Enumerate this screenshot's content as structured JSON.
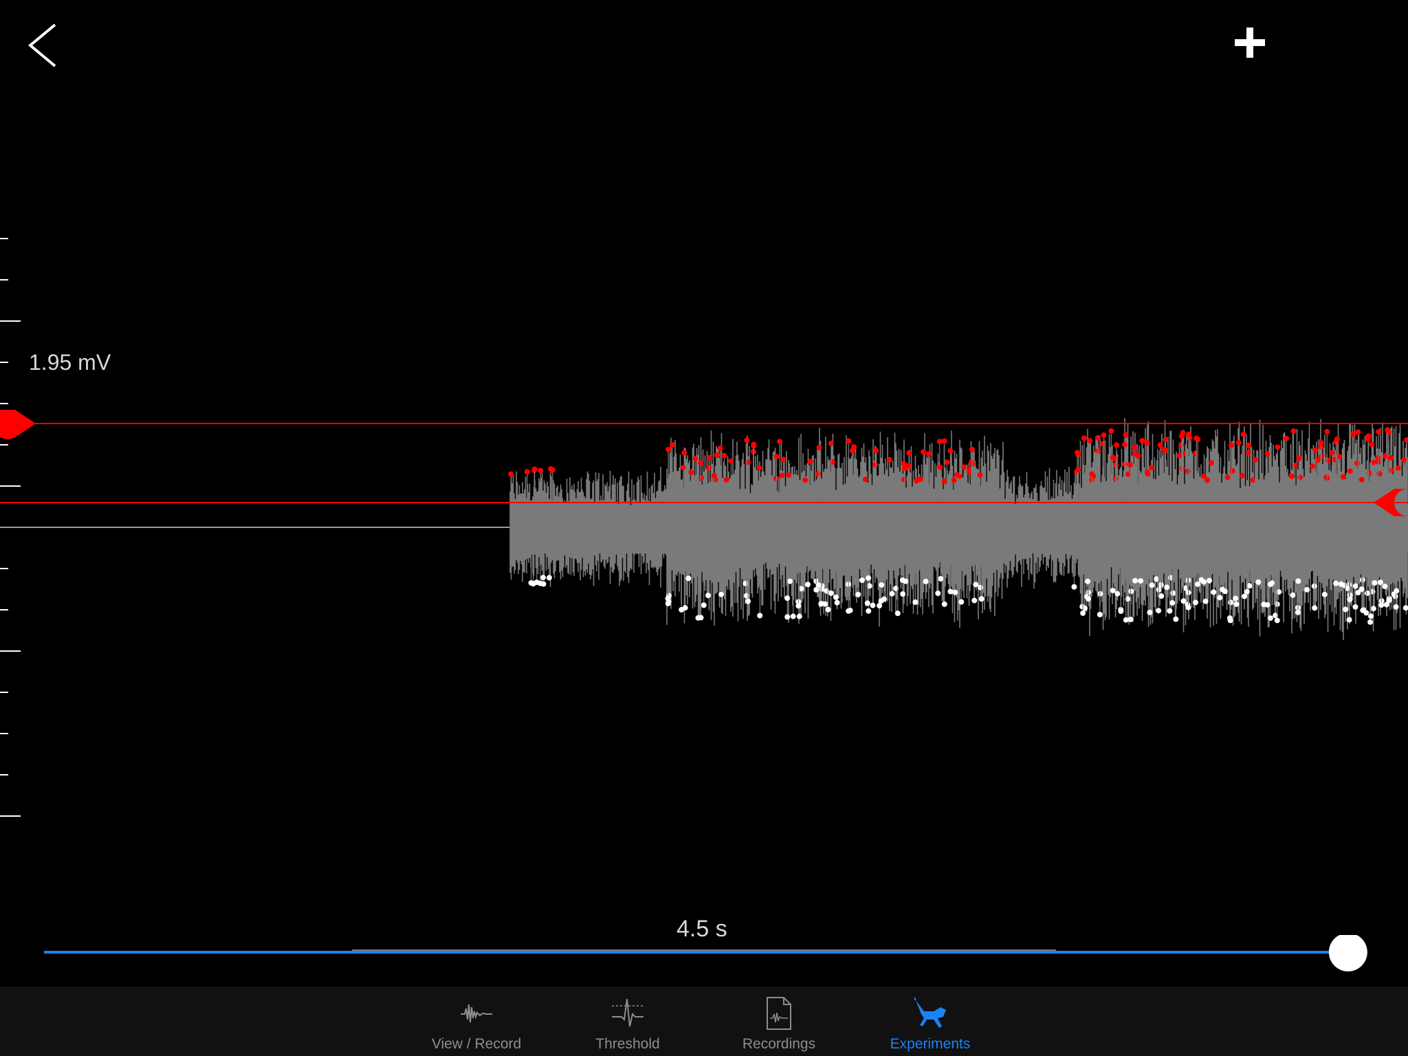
{
  "header": {
    "back_icon": "chevron-left-icon",
    "add_icon": "plus-icon"
  },
  "scope": {
    "scale_label": "1.95 mV",
    "time_label": "4.5 s"
  },
  "timeline": {
    "position_fraction": 0.99
  },
  "tabs": [
    {
      "label": "View / Record",
      "icon": "waveform-icon",
      "active": false
    },
    {
      "label": "Threshold",
      "icon": "threshold-spike-icon",
      "active": false
    },
    {
      "label": "Recordings",
      "icon": "recording-file-icon",
      "active": false
    },
    {
      "label": "Experiments",
      "icon": "grasshopper-icon",
      "active": true
    }
  ],
  "colors": {
    "background": "#000000",
    "threshold": "#ff0000",
    "signal": "#7a7a7a",
    "peak_low": "#ffffff",
    "accent": "#1a82f7",
    "inactive_tab": "#8e8e8e"
  }
}
